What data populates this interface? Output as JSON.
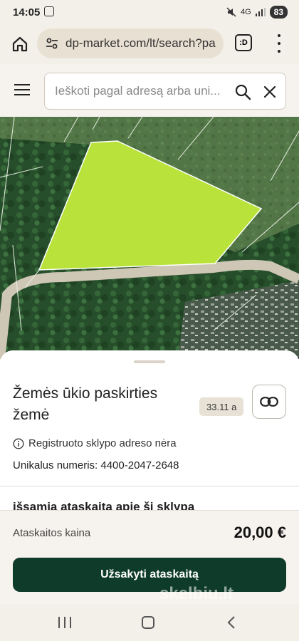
{
  "status_bar": {
    "time": "14:05",
    "network": "4G",
    "battery": "83"
  },
  "browser": {
    "url": "dp-market.com/lt/search?pa",
    "extension_label": ":D"
  },
  "search": {
    "placeholder": "Ieškoti pagal adresą arba uni..."
  },
  "parcel": {
    "title": "Žemės ūkio paskirties žemė",
    "area": "33.11 a",
    "address_note": "Registruoto sklypo adreso nėra",
    "unique_number": "Unikalus numeris: 4400-2047-2648",
    "report_heading": "išsamią ataskaitą apie šį sklypą"
  },
  "order": {
    "price_label": "Ataskaitos kaina",
    "price_value": "20,00 €",
    "button_label": "Užsakyti ataskaitą"
  },
  "watermark": "skelbiu.lt",
  "colors": {
    "parcel_fill": "#b9e23b",
    "primary_button": "#0f3b2a",
    "background": "#f6f3ee"
  },
  "icons": [
    "home-icon",
    "site-settings-icon",
    "extension-icon",
    "more-vertical-icon",
    "menu-icon",
    "search-icon",
    "close-icon",
    "link-icon",
    "info-icon",
    "recents-icon",
    "home-nav-icon",
    "back-icon"
  ]
}
